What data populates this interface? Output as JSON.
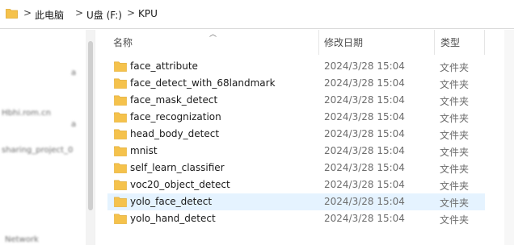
{
  "address": {
    "crumbs": [
      "此电脑",
      "U盘 (F:)",
      "KPU"
    ],
    "separator": ">"
  },
  "nav": {
    "blurred": [
      "a",
      "Hbhi.rom.cn",
      "a",
      "sharing_project_0",
      "Network"
    ]
  },
  "columns": {
    "name": "名称",
    "date": "修改日期",
    "type": "类型"
  },
  "files": [
    {
      "name": "face_attribute",
      "date": "2024/3/28 15:04",
      "type": "文件夹"
    },
    {
      "name": "face_detect_with_68landmark",
      "date": "2024/3/28 15:04",
      "type": "文件夹"
    },
    {
      "name": "face_mask_detect",
      "date": "2024/3/28 15:04",
      "type": "文件夹"
    },
    {
      "name": "face_recognization",
      "date": "2024/3/28 15:04",
      "type": "文件夹"
    },
    {
      "name": "head_body_detect",
      "date": "2024/3/28 15:04",
      "type": "文件夹"
    },
    {
      "name": "mnist",
      "date": "2024/3/28 15:04",
      "type": "文件夹"
    },
    {
      "name": "self_learn_classifier",
      "date": "2024/3/28 15:04",
      "type": "文件夹"
    },
    {
      "name": "voc20_object_detect",
      "date": "2024/3/28 15:04",
      "type": "文件夹"
    },
    {
      "name": "yolo_face_detect",
      "date": "2024/3/28 15:04",
      "type": "文件夹"
    },
    {
      "name": "yolo_hand_detect",
      "date": "2024/3/28 15:04",
      "type": "文件夹"
    }
  ],
  "colors": {
    "folder": "#f5c24c",
    "folder_dark": "#e0a82e",
    "hover": "#e5f3ff"
  },
  "state": {
    "hover_row": 8
  }
}
